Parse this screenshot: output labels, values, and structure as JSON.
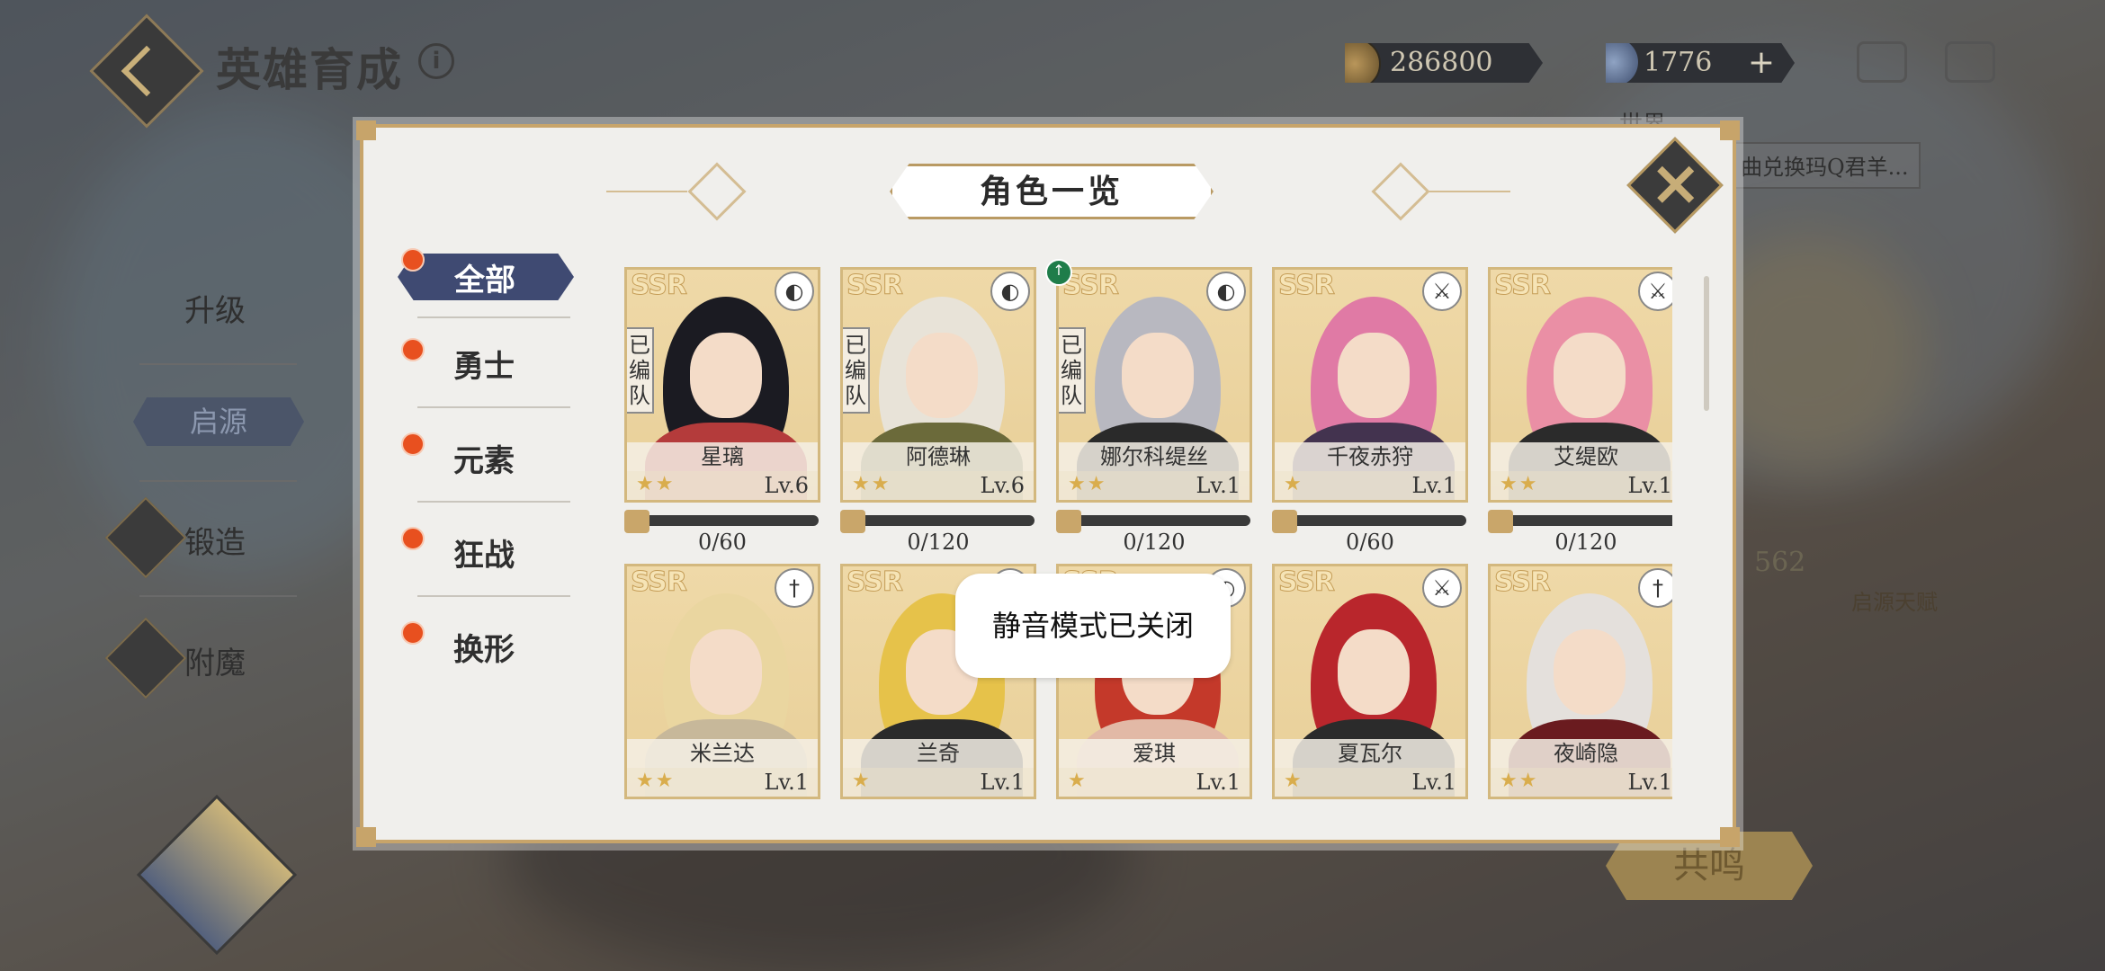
{
  "header": {
    "title": "英雄育成",
    "info_icon": "info-icon",
    "gold": "286800",
    "gems": "1776",
    "plus": "+"
  },
  "background": {
    "nav": [
      "升级",
      "启源",
      "锻造",
      "附魔"
    ],
    "chat_channel": "世界",
    "chat_text": "曲兑换玛Q君羊...",
    "number": "562",
    "talent": "启源天赋",
    "resonate": "共鸣"
  },
  "modal": {
    "title": "角色一览",
    "categories": [
      {
        "label": "全部"
      },
      {
        "label": "勇士"
      },
      {
        "label": "元素"
      },
      {
        "label": "狂战"
      },
      {
        "label": "换形"
      }
    ],
    "heroes": [
      {
        "name": "星璃",
        "level": "Lv.6",
        "stars": "★★",
        "team": "已编队",
        "frag": "0/60",
        "rarity": "SSR",
        "class_icon": "mask-icon",
        "hair": "#1b1b22",
        "accent": "#b43b3b"
      },
      {
        "name": "阿德琳",
        "level": "Lv.6",
        "stars": "★★",
        "team": "已编队",
        "frag": "0/120",
        "rarity": "SSR",
        "class_icon": "mask-icon",
        "hair": "#e8e3d8",
        "accent": "#6b6a3a"
      },
      {
        "name": "娜尔科缇丝",
        "level": "Lv.1",
        "stars": "★★",
        "team": "已编队",
        "frag": "0/120",
        "rarity": "SSR",
        "class_icon": "mask-icon",
        "hair": "#b8b8c0",
        "accent": "#2a2a2a"
      },
      {
        "name": "千夜赤狩",
        "level": "Lv.1",
        "stars": "★",
        "team": "",
        "frag": "0/60",
        "rarity": "SSR",
        "class_icon": "axe-icon",
        "hair": "#e07aa5",
        "accent": "#43334f"
      },
      {
        "name": "艾缇欧",
        "level": "Lv.1",
        "stars": "★★",
        "team": "",
        "frag": "0/120",
        "rarity": "SSR",
        "class_icon": "axe-icon",
        "hair": "#ea8fa5",
        "accent": "#2b2b2b"
      },
      {
        "name": "米兰达",
        "level": "Lv.1",
        "stars": "★★",
        "team": "",
        "frag": "",
        "rarity": "SSR",
        "class_icon": "sword-icon",
        "hair": "#ead6a0",
        "accent": "#c7b89a"
      },
      {
        "name": "兰奇",
        "level": "Lv.1",
        "stars": "★",
        "team": "",
        "frag": "",
        "rarity": "SSR",
        "class_icon": "axe-icon",
        "hair": "#e6c24a",
        "accent": "#2a2a2a"
      },
      {
        "name": "爱琪",
        "level": "Lv.1",
        "stars": "★",
        "team": "",
        "frag": "",
        "rarity": "SSR",
        "class_icon": "mask-icon",
        "hair": "#c4392a",
        "accent": "#e2b9a6"
      },
      {
        "name": "夏瓦尔",
        "level": "Lv.1",
        "stars": "★",
        "team": "",
        "frag": "",
        "rarity": "SSR",
        "class_icon": "axe-icon",
        "hair": "#b9262c",
        "accent": "#2b2b2b"
      },
      {
        "name": "夜崎隐",
        "level": "Lv.1",
        "stars": "★★",
        "team": "",
        "frag": "",
        "rarity": "SSR",
        "class_icon": "sword-icon",
        "hair": "#e4e0dc",
        "accent": "#6a1b1f"
      }
    ],
    "toast": "静音模式已关闭"
  }
}
